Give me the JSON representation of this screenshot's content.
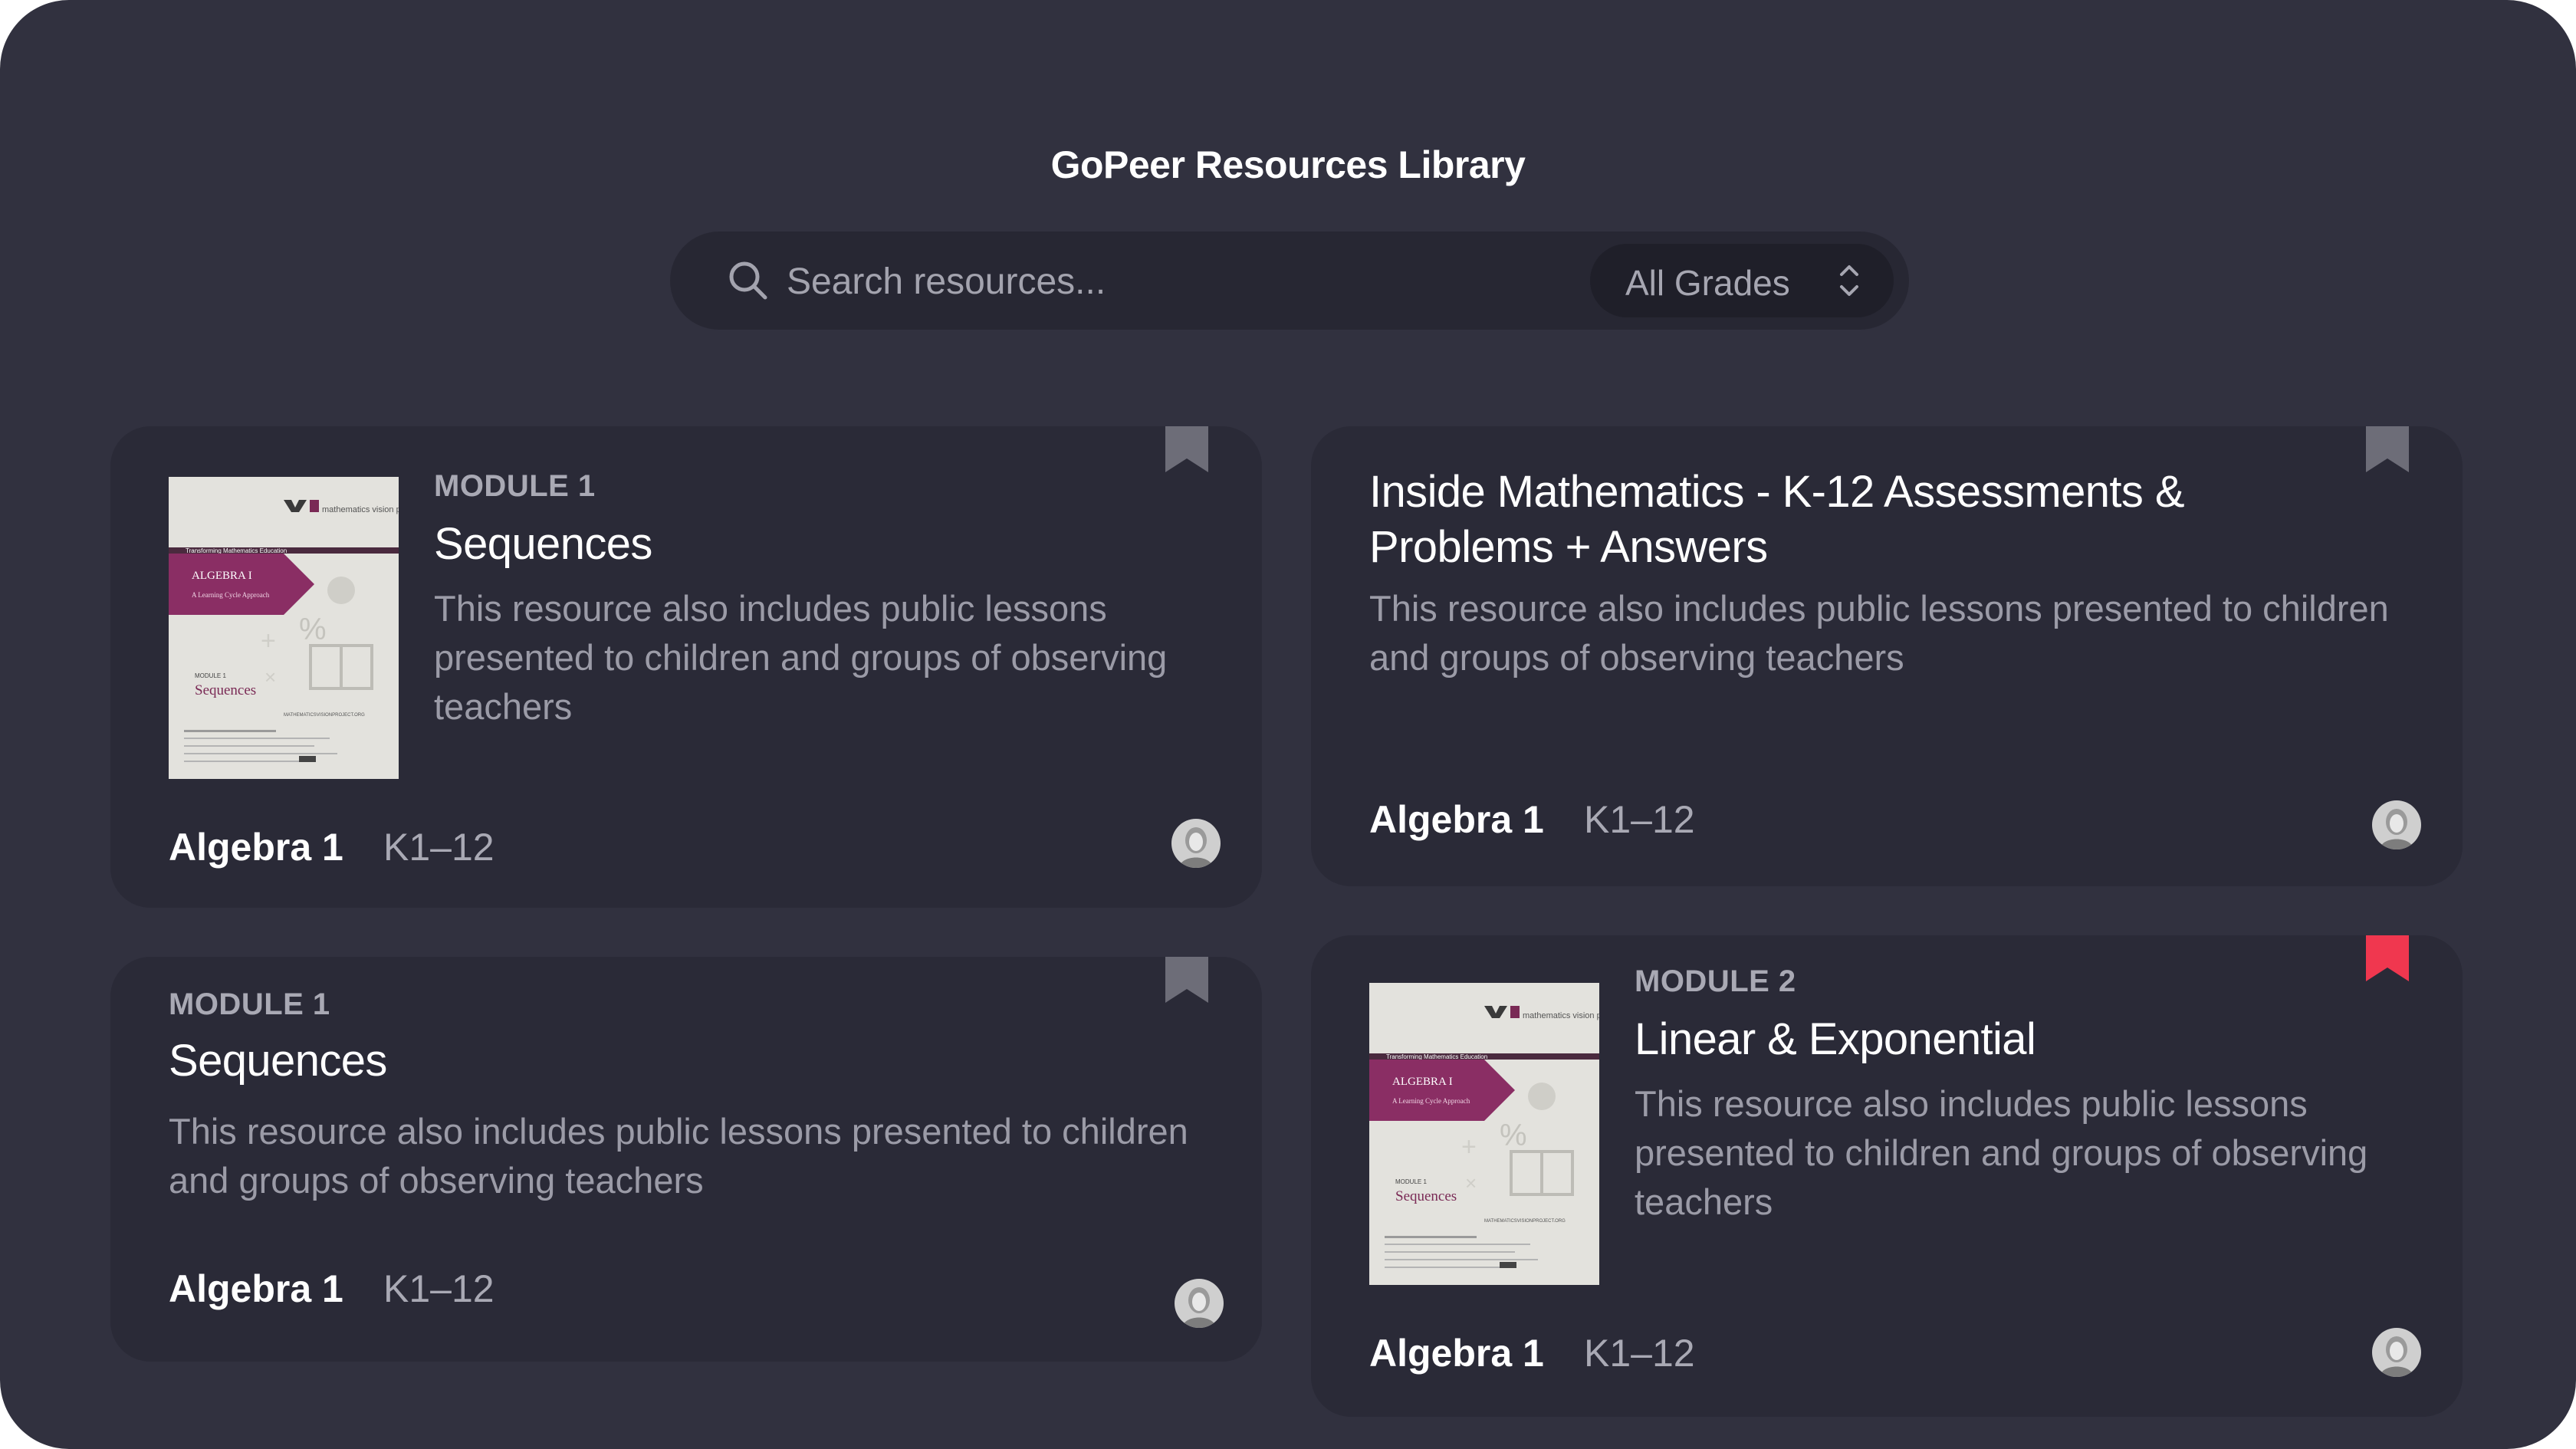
{
  "page": {
    "title": "GoPeer Resources Library"
  },
  "search": {
    "placeholder": "Search resources...",
    "grade_filter": "All Grades"
  },
  "colors": {
    "background": "#31313f",
    "card": "#2a2a37",
    "bookmark_inactive": "#6d6d78",
    "bookmark_active": "#f0374f"
  },
  "cards": [
    {
      "module": "MODULE 1",
      "title": "Sequences",
      "description": "This resource also includes public lessons presented to children and groups of observing teachers",
      "subject": "Algebra 1",
      "grade": "K1–12",
      "bookmarked": false,
      "has_thumbnail": true,
      "thumbnail": {
        "logo": "mathematics vision project",
        "banner_top": "Transforming Mathematics Education",
        "course": "ALGEBRA I",
        "approach": "A Learning Cycle Approach",
        "module_small": "MODULE 1",
        "module_title": "Sequences",
        "url": "MATHEMATICSVISIONPROJECT.ORG"
      }
    },
    {
      "module": "",
      "title": "Inside Mathematics - K-12 Assessments & Problems + Answers",
      "description": "This resource also includes public lessons presented to children and groups of observing teachers",
      "subject": "Algebra 1",
      "grade": "K1–12",
      "bookmarked": false,
      "has_thumbnail": false
    },
    {
      "module": "MODULE 1",
      "title": "Sequences",
      "description": "This resource also includes public lessons presented to children and groups of observing teachers",
      "subject": "Algebra 1",
      "grade": "K1–12",
      "bookmarked": false,
      "has_thumbnail": false
    },
    {
      "module": "MODULE 2",
      "title": "Linear & Exponential",
      "description": "This resource also includes public lessons presented to children and groups of observing teachers",
      "subject": "Algebra 1",
      "grade": "K1–12",
      "bookmarked": true,
      "has_thumbnail": true,
      "thumbnail": {
        "logo": "mathematics vision project",
        "banner_top": "Transforming Mathematics Education",
        "course": "ALGEBRA I",
        "approach": "A Learning Cycle Approach",
        "module_small": "MODULE 1",
        "module_title": "Sequences",
        "url": "MATHEMATICSVISIONPROJECT.ORG"
      }
    }
  ]
}
